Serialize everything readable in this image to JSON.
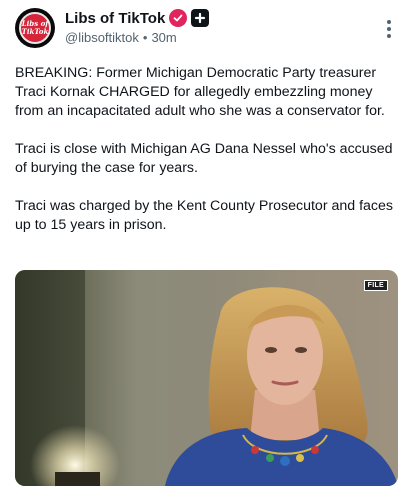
{
  "author": {
    "display_name": "Libs of TikTok",
    "handle": "@libsoftiktok",
    "separator": "•",
    "time": "30m",
    "avatar_line1": "Libs of",
    "avatar_line2": "TikTok",
    "verified_color": "#e0245e"
  },
  "post": {
    "paragraphs": [
      "BREAKING: Former Michigan Democratic Party treasurer Traci Kornak CHARGED for allegedly embezzling money from an incapacitated adult who she was a conservator for.",
      "Traci is close with Michigan AG Dana Nessel who's accused of burying the case for years.",
      "Traci was charged by the Kent County Prosecutor and faces up to 15 years in prison."
    ]
  },
  "media": {
    "tag": "FILE"
  },
  "icons": {
    "verified": "verified-badge-icon",
    "subscriber": "plus-badge-icon",
    "more": "more-options-icon"
  }
}
